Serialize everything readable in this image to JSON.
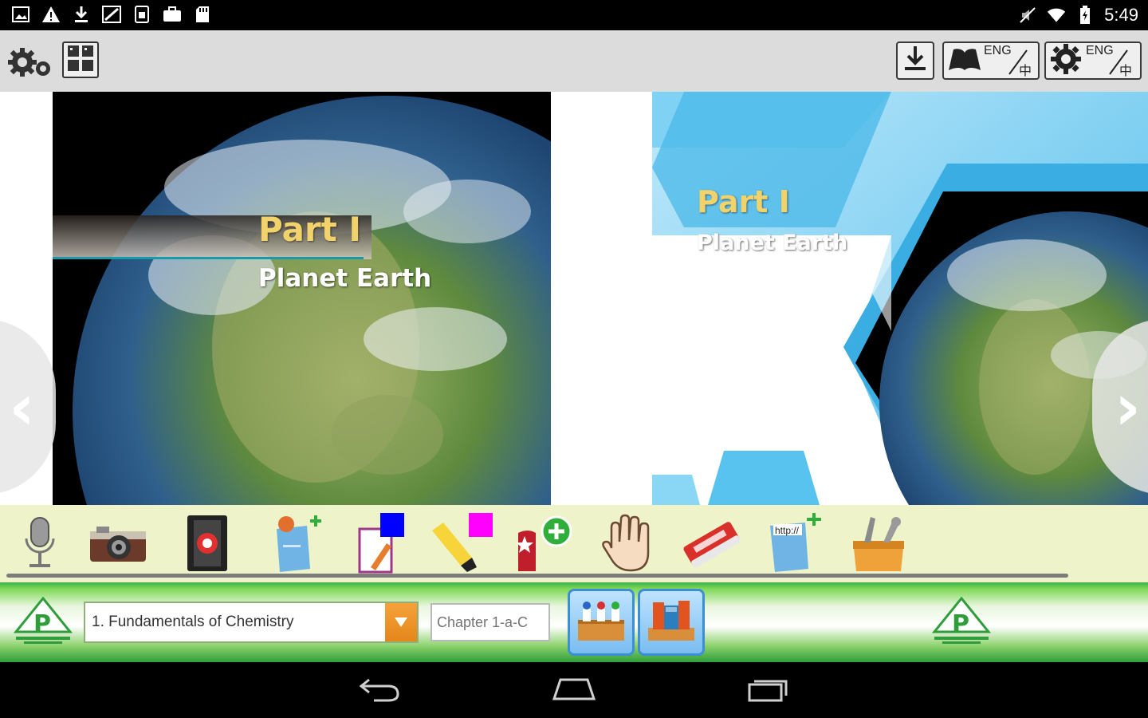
{
  "status_bar": {
    "time": "5:49",
    "left_icons": [
      "image-icon",
      "warning-icon",
      "download-icon",
      "screenshot-icon",
      "sim-icon",
      "briefcase-icon",
      "sd-card-icon"
    ],
    "right_icons": [
      "mute-icon",
      "wifi-icon",
      "battery-icon"
    ]
  },
  "top_toolbar": {
    "settings_icon": "gears-icon",
    "grid_icon": "grid-icon",
    "download_icon": "download-icon",
    "book_lang": {
      "icon": "book-icon",
      "text_top": "ENG",
      "text_bottom": "中"
    },
    "settings_lang": {
      "icon": "gear-icon",
      "text_top": "ENG",
      "text_bottom": "中"
    }
  },
  "book": {
    "left_page": {
      "title": "Part I",
      "subtitle": "Planet Earth"
    },
    "right_page": {
      "title": "Part I",
      "subtitle": "Planet Earth"
    },
    "prev_arrow": "‹",
    "next_arrow": "›"
  },
  "tools": [
    {
      "name": "microphone-tool",
      "icon": "microphone-icon"
    },
    {
      "name": "camera-tool",
      "icon": "camera-icon"
    },
    {
      "name": "video-tool",
      "icon": "video-icon"
    },
    {
      "name": "add-note-tool",
      "icon": "note-add-icon"
    },
    {
      "name": "color-pen-tool",
      "icon": "pen-color-icon",
      "color": "#0000ff"
    },
    {
      "name": "highlighter-tool",
      "icon": "highlighter-icon",
      "color": "#ff00ff"
    },
    {
      "name": "add-bookmark-tool",
      "icon": "bookmark-add-icon"
    },
    {
      "name": "hand-tool",
      "icon": "hand-icon"
    },
    {
      "name": "eraser-tool",
      "icon": "eraser-icon"
    },
    {
      "name": "add-link-tool",
      "icon": "link-add-icon"
    },
    {
      "name": "toolbox-tool",
      "icon": "toolbox-icon"
    }
  ],
  "app_bar": {
    "chapter_value": "1. Fundamentals of Chemistry",
    "chapter_placeholder": "Chapter 1-a-C",
    "left_logo": "publisher-logo",
    "right_logo": "publisher-logo",
    "shelf_buttons": [
      "bookshelf-icon",
      "books-icon"
    ]
  },
  "nav_bar": [
    "back-icon",
    "home-icon",
    "recents-icon"
  ],
  "colors": {
    "title_gold": "#f2d36b",
    "tools_bg": "#eef3c9",
    "app_bar_green": "#3cb04a",
    "select_arrow": "#e5861a",
    "shelf_blue": "#3d8fd3"
  }
}
